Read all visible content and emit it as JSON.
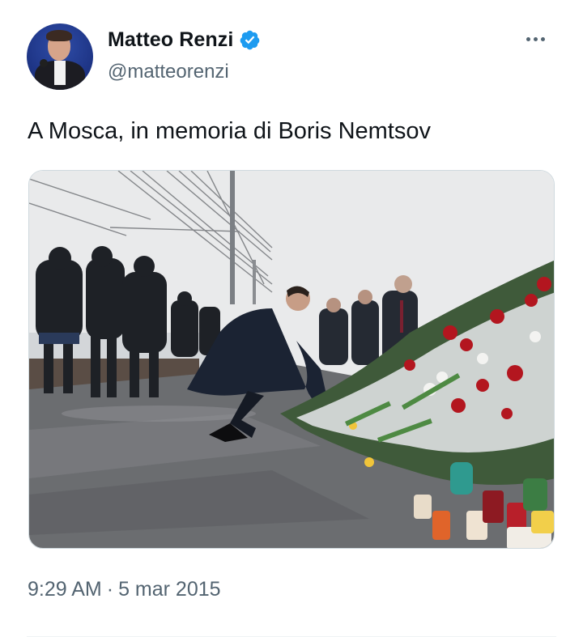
{
  "tweet": {
    "author": {
      "display_name": "Matteo Renzi",
      "handle": "@matteorenzi",
      "verified": true,
      "avatar_icon": "profile-photo",
      "verified_icon": "verified-badge-icon"
    },
    "text": "A Mosca, in memoria di Boris Nemtsov",
    "time": "9:29 AM",
    "date": "5 mar 2015",
    "separator": "·",
    "more_icon": "more-options-icon"
  },
  "colors": {
    "text_primary": "#0f1419",
    "text_secondary": "#536471",
    "verified_blue": "#1d9bf0",
    "border": "#cfd9de"
  }
}
